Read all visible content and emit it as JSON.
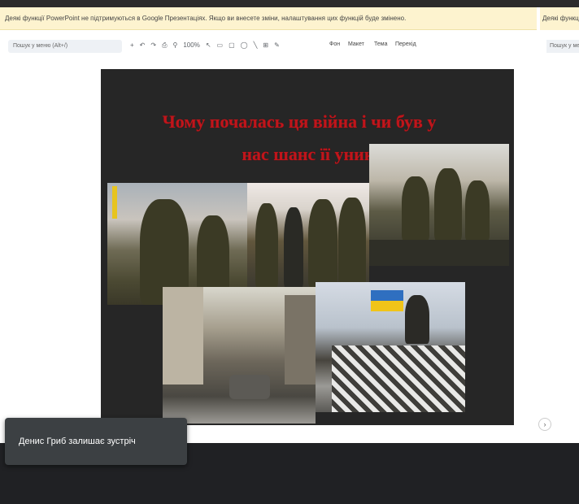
{
  "banner": {
    "message": "Деякі функції PowerPoint не підтримуються в Google Презентаціях. Якщо ви внесете зміни, налаштування цих функцій буде змінено.",
    "right_fragment": "Деякі функції"
  },
  "toolbar": {
    "search_placeholder": "Пошук у меню (Alt+/)",
    "right_search": "Пошук у меню",
    "items": [
      "+",
      "↶",
      "↷",
      "⎙",
      "⚲",
      "100%",
      "↖",
      "▭",
      "▢",
      "◯",
      "╲",
      "⊞",
      "✎"
    ],
    "text_buttons": [
      "Фон",
      "Макет",
      "Тема",
      "Перехід"
    ]
  },
  "slide": {
    "title_line1": "Чому почалась ця війна і чи був у",
    "title_line2": "нас шанс її уникнути?"
  },
  "toast": {
    "message": "Денис Гриб залишає зустріч"
  },
  "colors": {
    "title_red": "#c0151b",
    "banner_bg": "#fdf3cf",
    "slide_bg": "#262626",
    "flag_blue": "#2f6fc0",
    "flag_yellow": "#f0c419"
  }
}
